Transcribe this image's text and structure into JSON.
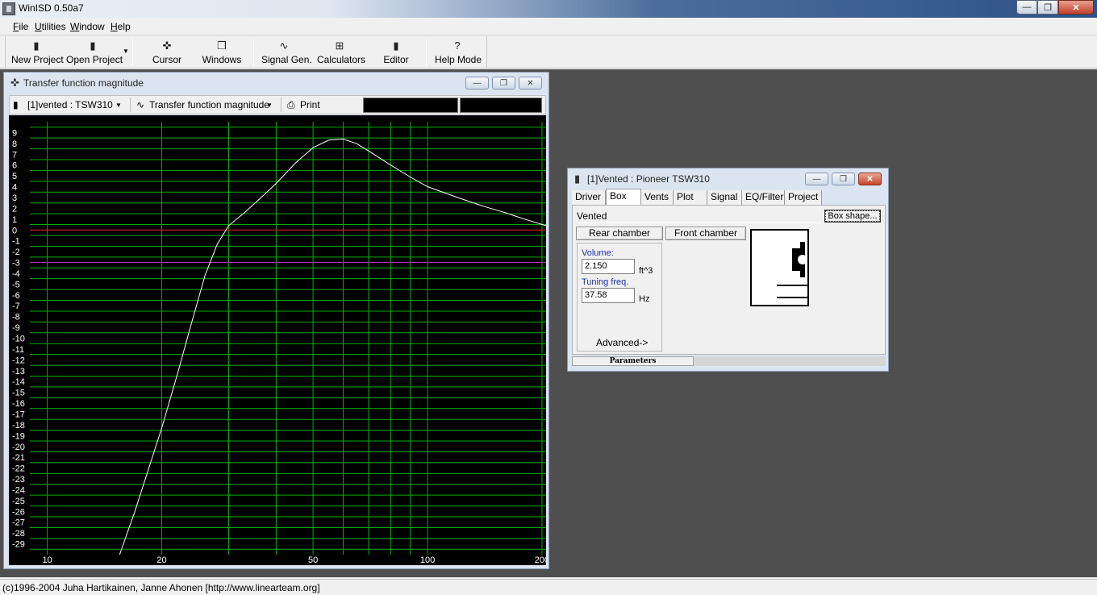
{
  "app": {
    "title": "WinISD 0.50a7"
  },
  "menu": [
    "File",
    "Utilities",
    "Window",
    "Help"
  ],
  "toolbar": {
    "new_project": "New Project",
    "open_project": "Open Project",
    "cursor": "Cursor",
    "windows": "Windows",
    "signal_gen": "Signal Gen.",
    "calculators": "Calculators",
    "editor": "Editor",
    "help_mode": "Help Mode"
  },
  "graph_window": {
    "title": "Transfer function magnitude",
    "project_select": "[1]vented : TSW310",
    "graph_select": "Transfer function magnitude",
    "print": "Print"
  },
  "box_window": {
    "title": "[1]Vented : Pioneer TSW310",
    "tabs": [
      "Driver",
      "Box",
      "Vents",
      "Plot",
      "Signal",
      "EQ/Filter",
      "Project"
    ],
    "active_tab": "Box",
    "box_type": "Vented",
    "box_shape_button": "Box shape...",
    "rear_chamber": "Rear chamber",
    "front_chamber": "Front chamber",
    "volume_label": "Volume:",
    "volume_value": "2.150",
    "volume_unit": "ft^3",
    "tuning_label": "Tuning freq.",
    "tuning_value": "37.58",
    "tuning_unit": "Hz",
    "advanced": "Advanced->",
    "status_tab": "Parameters"
  },
  "statusbar": {
    "text": "(c)1996-2004 Juha Hartikainen, Janne Ahonen [http://www.linearteam.org]"
  },
  "colors": {
    "plot_bg": "#000000",
    "grid": "#00b000",
    "zero_line": "#ff2020",
    "minus3_line": "#b030b0",
    "curve": "#ffffff",
    "workspace": "#4f4f4f"
  },
  "chart_data": {
    "type": "line",
    "title": "Transfer function magnitude",
    "x_scale": "log",
    "xlim": [
      9,
      205
    ],
    "ylim": [
      -30,
      10
    ],
    "x_ticks": [
      10,
      20,
      50,
      100,
      200
    ],
    "x_grid": [
      10,
      20,
      30,
      40,
      50,
      60,
      70,
      80,
      90,
      100,
      200
    ],
    "y_ticks": [
      9,
      8,
      7,
      6,
      5,
      4,
      3,
      2,
      1,
      0,
      -1,
      -2,
      -3,
      -4,
      -5,
      -6,
      -7,
      -8,
      -9,
      -10,
      -11,
      -12,
      -13,
      -14,
      -15,
      -16,
      -17,
      -18,
      -19,
      -20,
      -21,
      -22,
      -23,
      -24,
      -25,
      -26,
      -27,
      -28,
      -29
    ],
    "reference_lines": [
      0,
      -3
    ],
    "series": [
      {
        "x": [
          15.5,
          17,
          18.5,
          20,
          22,
          24,
          26,
          28,
          30,
          33,
          36,
          40,
          45,
          50,
          55,
          60,
          65,
          70,
          80,
          90,
          100,
          120,
          140,
          160,
          180,
          205
        ],
        "y": [
          -30,
          -26,
          -22,
          -18.3,
          -13.3,
          -8.5,
          -4.2,
          -1.3,
          0.4,
          1.6,
          2.8,
          4.3,
          6.2,
          7.6,
          8.3,
          8.4,
          8.0,
          7.3,
          6.0,
          4.9,
          4.0,
          3.0,
          2.2,
          1.6,
          1.0,
          0.4
        ]
      }
    ]
  }
}
